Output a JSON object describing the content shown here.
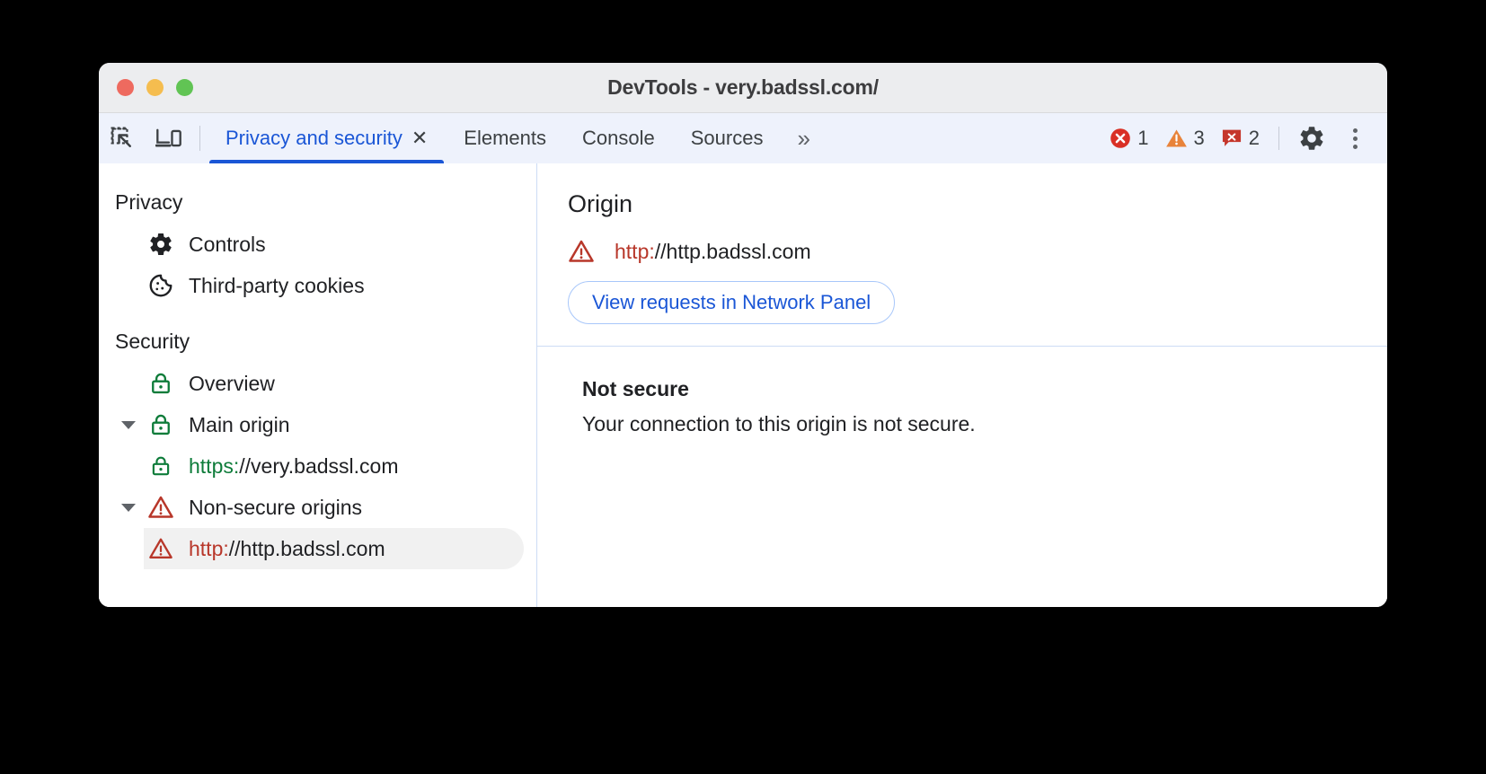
{
  "window": {
    "title": "DevTools - very.badssl.com/",
    "traffic_lights": [
      "close",
      "minimize",
      "maximize"
    ]
  },
  "toolbar": {
    "inspect_icon": "inspect-element-icon",
    "device_icon": "device-toolbar-icon",
    "tabs": [
      {
        "label": "Privacy and security",
        "active": true,
        "closable": true,
        "close_glyph": "✕"
      },
      {
        "label": "Elements",
        "active": false,
        "closable": false
      },
      {
        "label": "Console",
        "active": false,
        "closable": false
      },
      {
        "label": "Sources",
        "active": false,
        "closable": false
      }
    ],
    "more_tabs_glyph": "»",
    "counters": [
      {
        "name": "errors",
        "icon": "error-icon",
        "count": "1",
        "color": "#d93025"
      },
      {
        "name": "warnings",
        "icon": "warning-icon",
        "count": "3",
        "color": "#e8833a"
      },
      {
        "name": "issues",
        "icon": "issue-icon",
        "count": "2",
        "color": "#c5362b"
      }
    ],
    "settings_icon": "gear-icon",
    "menu_icon": "kebab-menu-icon"
  },
  "sidebar": {
    "sections": [
      {
        "title": "Privacy",
        "items": [
          {
            "label": "Controls",
            "icon": "gear-icon",
            "indent": 1,
            "twisty": false,
            "selected": false
          },
          {
            "label": "Third-party cookies",
            "icon": "cookie-icon",
            "indent": 1,
            "twisty": false,
            "selected": false
          }
        ]
      },
      {
        "title": "Security",
        "items": [
          {
            "label": "Overview",
            "icon": "lock-green-icon",
            "indent": 1,
            "twisty": false,
            "selected": false
          },
          {
            "label": "Main origin",
            "icon": "lock-green-icon",
            "indent": 1,
            "twisty": true,
            "selected": false
          },
          {
            "scheme": "https:",
            "host": "//very.badssl.com",
            "scheme_color": "green",
            "icon": "lock-green-icon",
            "indent": 2,
            "twisty": false,
            "selected": false
          },
          {
            "label": "Non-secure origins",
            "icon": "warning-triangle-icon",
            "indent": 1,
            "twisty": true,
            "selected": false
          },
          {
            "scheme": "http:",
            "host": "//http.badssl.com",
            "scheme_color": "red",
            "icon": "warning-triangle-icon",
            "indent": 2,
            "twisty": false,
            "selected": true
          }
        ]
      }
    ]
  },
  "main": {
    "origin_heading": "Origin",
    "origin_icon": "warning-triangle-icon",
    "origin_scheme": "http:",
    "origin_host": "//http.badssl.com",
    "view_requests_button": "View requests in Network Panel",
    "detail_title": "Not secure",
    "detail_text": "Your connection to this origin is not secure."
  },
  "colors": {
    "accent_blue": "#1a56d6",
    "secure_green": "#0e7c3a",
    "insecure_red": "#b8372a",
    "tabbar_bg": "#eef2fc",
    "titlebar_bg": "#ecedef",
    "selected_row_bg": "#f1f1f1"
  }
}
